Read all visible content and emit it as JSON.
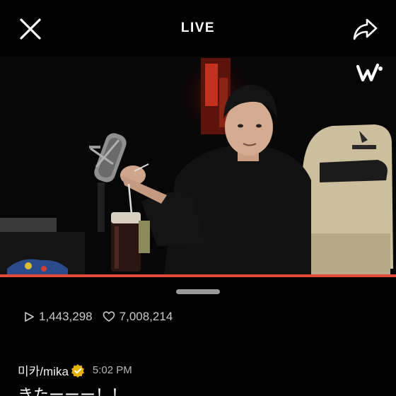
{
  "header": {
    "title": "LIVE",
    "close_icon": "close-icon",
    "share_icon": "share-icon"
  },
  "video": {
    "brand_icon": "weverse-logo-icon",
    "progress_percent": 100,
    "accent_color": "#e24a3a"
  },
  "stats": {
    "plays": "1,443,298",
    "likes": "7,008,214",
    "play_icon": "play-icon",
    "like_icon": "heart-icon"
  },
  "comment": {
    "username": "미카/mika",
    "badge_icon": "verified-badge-icon",
    "time": "5:02 PM",
    "text": "きたーーー！！"
  }
}
